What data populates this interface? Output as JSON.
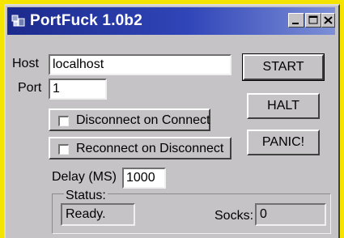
{
  "window": {
    "title": "PortFuck 1.0b2"
  },
  "form": {
    "host_label": "Host",
    "host_value": "localhost",
    "port_label": "Port",
    "port_value": "1",
    "disconnect_label": "Disconnect on Connect",
    "reconnect_label": "Reconnect on Disconnect",
    "delay_label": "Delay (MS)",
    "delay_value": "1000"
  },
  "buttons": {
    "start": "START",
    "halt": "HALT",
    "panic": "PANIC!"
  },
  "status": {
    "label": "Status:",
    "value": "Ready.",
    "socks_label": "Socks:",
    "socks_value": "0"
  },
  "colors": {
    "background": "#f5e400",
    "window_face": "#c6c3c6",
    "titlebar_start": "#1c2a8c",
    "titlebar_end": "#7d8fd6"
  },
  "icons": [
    "app-icon",
    "minimize-icon",
    "maximize-icon",
    "close-icon"
  ]
}
